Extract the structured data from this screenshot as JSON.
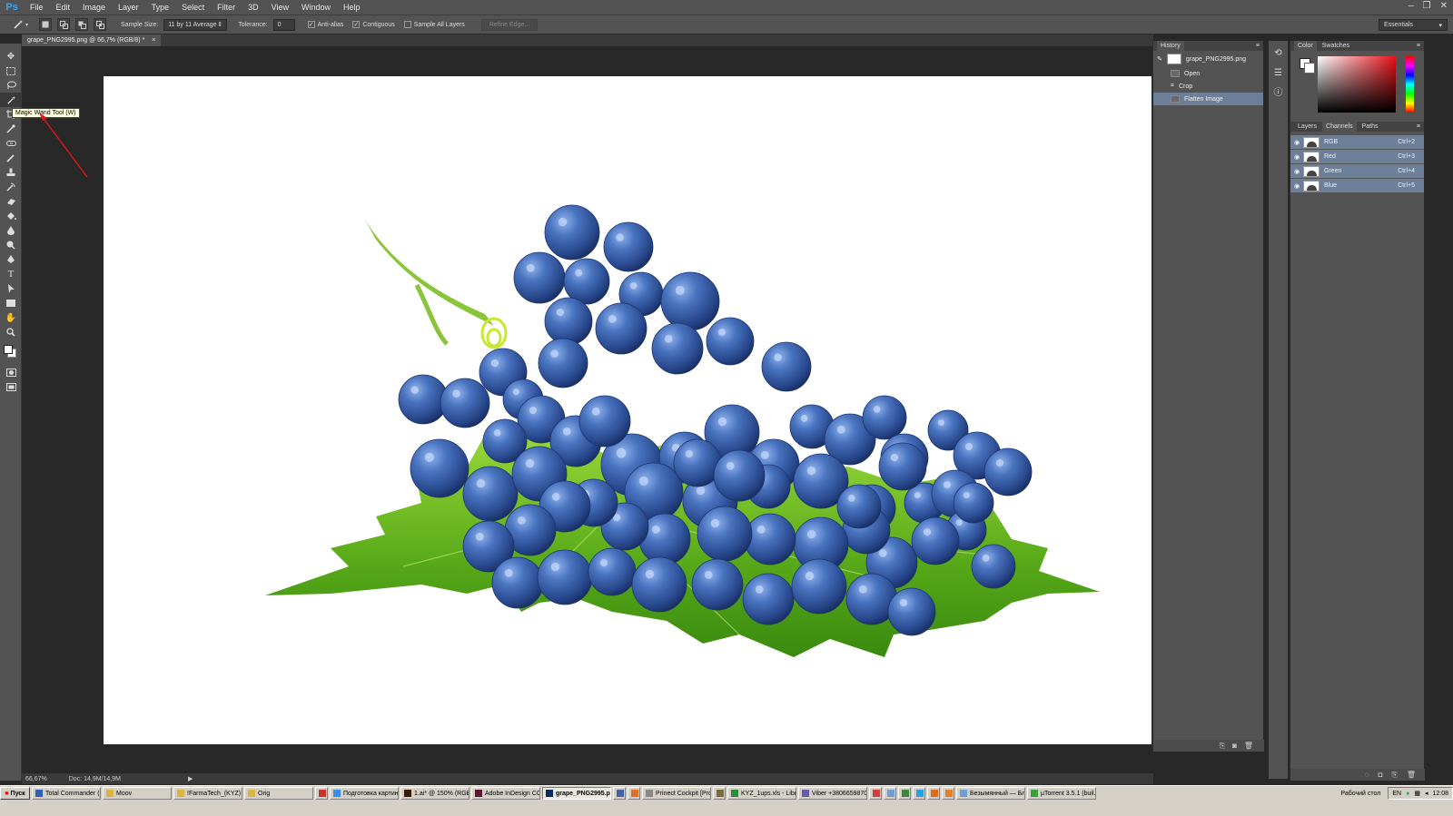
{
  "app": {
    "logo": "Ps"
  },
  "menu": [
    "File",
    "Edit",
    "Image",
    "Layer",
    "Type",
    "Select",
    "Filter",
    "3D",
    "View",
    "Window",
    "Help"
  ],
  "window_controls": [
    "–",
    "❐",
    "✕"
  ],
  "options": {
    "sample_size_label": "Sample Size:",
    "sample_size_value": "11 by 11 Average",
    "tolerance_label": "Tolerance:",
    "tolerance_value": "0",
    "anti_alias": "Anti-alias",
    "contiguous": "Contiguous",
    "sample_all_layers": "Sample All Layers",
    "refine_edge": "Refine Edge...",
    "workspace": "Essentials"
  },
  "tooltip": "Magic Wand Tool (W)",
  "document": {
    "tab": "grape_PNG2995.png @ 66,7% (RGB/8) *",
    "zoom": "66,67%",
    "doc_size": "Doc: 14,9M/14,9M"
  },
  "history": {
    "title": "History",
    "snapshot": "grape_PNG2995.png",
    "steps": [
      {
        "label": "Open",
        "selected": false
      },
      {
        "label": "Crop",
        "selected": false
      },
      {
        "label": "Flatten Image",
        "selected": true
      }
    ]
  },
  "color_panel": {
    "tabs": [
      "Color",
      "Swatches"
    ]
  },
  "layers_panel": {
    "tabs": [
      "Layers",
      "Channels",
      "Paths"
    ],
    "active_tab": "Channels",
    "channels": [
      {
        "name": "RGB",
        "shortcut": "Ctrl+2"
      },
      {
        "name": "Red",
        "shortcut": "Ctrl+3"
      },
      {
        "name": "Green",
        "shortcut": "Ctrl+4"
      },
      {
        "name": "Blue",
        "shortcut": "Ctrl+5"
      }
    ]
  },
  "taskbar": {
    "start": "Пуск",
    "tasks": [
      {
        "label": "Total Commander (x...",
        "color": "#2e64b8"
      },
      {
        "label": "Moov",
        "color": "#d9b640"
      },
      {
        "label": "!FarmaTech_(KYZ)",
        "color": "#d9b640"
      },
      {
        "label": "Orig",
        "color": "#d9b640"
      },
      {
        "label": "",
        "color": "#c8352c"
      },
      {
        "label": "Подготовка картин...",
        "color": "#3a8ee6"
      },
      {
        "label": "1.ai* @ 150% (RGB/...",
        "color": "#3a1a00"
      },
      {
        "label": "Adobe InDesign CC ...",
        "color": "#5a1635"
      },
      {
        "label": "grape_PNG2995.p...",
        "color": "#0b2c5a"
      },
      {
        "label": "",
        "color": "#4463a8"
      },
      {
        "label": "",
        "color": "#e07020"
      },
      {
        "label": "Prinect Cockpit [Prod...",
        "color": "#888888"
      },
      {
        "label": "",
        "color": "#7a6a40"
      },
      {
        "label": "KYZ_1ups.xls - Libre...",
        "color": "#2e8a3e"
      },
      {
        "label": "Viber +380665987030",
        "color": "#665cac"
      },
      {
        "label": "",
        "color": "#d04040"
      },
      {
        "label": "",
        "color": "#6aa0d8"
      },
      {
        "label": "",
        "color": "#3a8a3a"
      },
      {
        "label": "",
        "color": "#2aa0e0"
      },
      {
        "label": "",
        "color": "#e06a20"
      },
      {
        "label": "",
        "color": "#e08030"
      },
      {
        "label": "Безымянный — Бло...",
        "color": "#6aa0d8"
      },
      {
        "label": "µTorrent 3.5.1 (buil...",
        "color": "#3aa03a"
      }
    ],
    "tray_label": "Рабочий стол",
    "lang": "EN",
    "time": "12:08"
  }
}
